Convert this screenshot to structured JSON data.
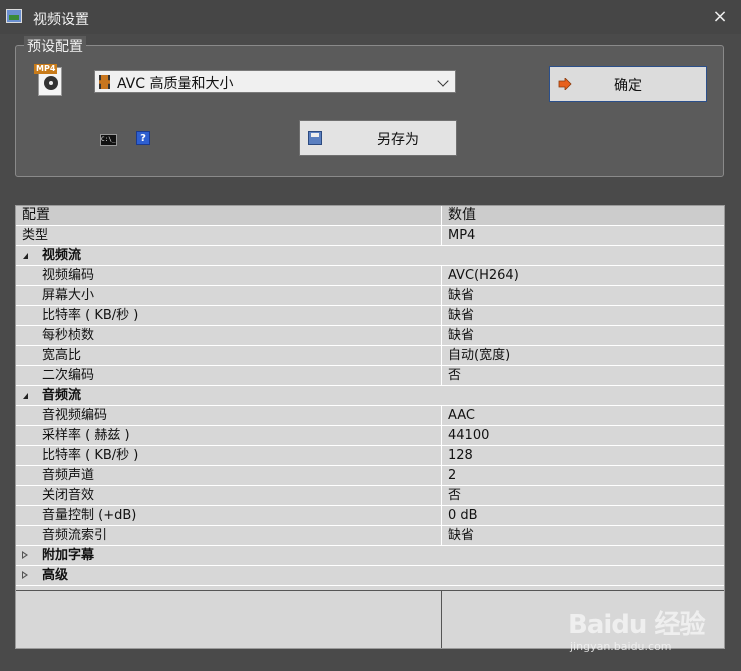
{
  "window": {
    "title": "视频设置",
    "close_label": "×"
  },
  "preset": {
    "group_title": "预设配置",
    "file_icon_tag": "MP4",
    "selected": "AVC 高质量和大小",
    "ok_label": "确定",
    "save_as_label": "另存为",
    "cmd_icon_text": "C:\\_",
    "help_icon_text": "?"
  },
  "grid": {
    "header": {
      "key": "配置",
      "value": "数值"
    },
    "rows": [
      {
        "type": "prop",
        "indent": 0,
        "key": "类型",
        "value": "MP4"
      },
      {
        "type": "category",
        "expanded": true,
        "key": "视频流"
      },
      {
        "type": "prop",
        "indent": 1,
        "key": "视频编码",
        "value": "AVC(H264)"
      },
      {
        "type": "prop",
        "indent": 1,
        "key": "屏幕大小",
        "value": "缺省"
      },
      {
        "type": "prop",
        "indent": 1,
        "key": "比特率 ( KB/秒 )",
        "value": "缺省"
      },
      {
        "type": "prop",
        "indent": 1,
        "key": "每秒桢数",
        "value": "缺省"
      },
      {
        "type": "prop",
        "indent": 1,
        "key": "宽高比",
        "value": "自动(宽度)"
      },
      {
        "type": "prop",
        "indent": 1,
        "key": "二次编码",
        "value": "否"
      },
      {
        "type": "category",
        "expanded": true,
        "key": "音频流"
      },
      {
        "type": "prop",
        "indent": 1,
        "key": "音视频编码",
        "value": "AAC"
      },
      {
        "type": "prop",
        "indent": 1,
        "key": "采样率 ( 赫兹 )",
        "value": "44100"
      },
      {
        "type": "prop",
        "indent": 1,
        "key": "比特率 ( KB/秒 )",
        "value": "128"
      },
      {
        "type": "prop",
        "indent": 1,
        "key": "音频声道",
        "value": "2"
      },
      {
        "type": "prop",
        "indent": 1,
        "key": "关闭音效",
        "value": "否"
      },
      {
        "type": "prop",
        "indent": 1,
        "key": "音量控制 (+dB)",
        "value": "0 dB"
      },
      {
        "type": "prop",
        "indent": 1,
        "key": "音频流索引",
        "value": "缺省"
      },
      {
        "type": "category",
        "expanded": false,
        "key": "附加字幕"
      },
      {
        "type": "category",
        "expanded": false,
        "key": "高级"
      }
    ]
  },
  "watermark": {
    "brand": "Baidu 经验",
    "url": "jingyan.baidu.com"
  },
  "colors": {
    "window_bg": "#4a4a4a",
    "grid_bg": "#d7d7d7",
    "ok_border": "#2b4f8a",
    "ok_arrow": "#e8601c"
  }
}
